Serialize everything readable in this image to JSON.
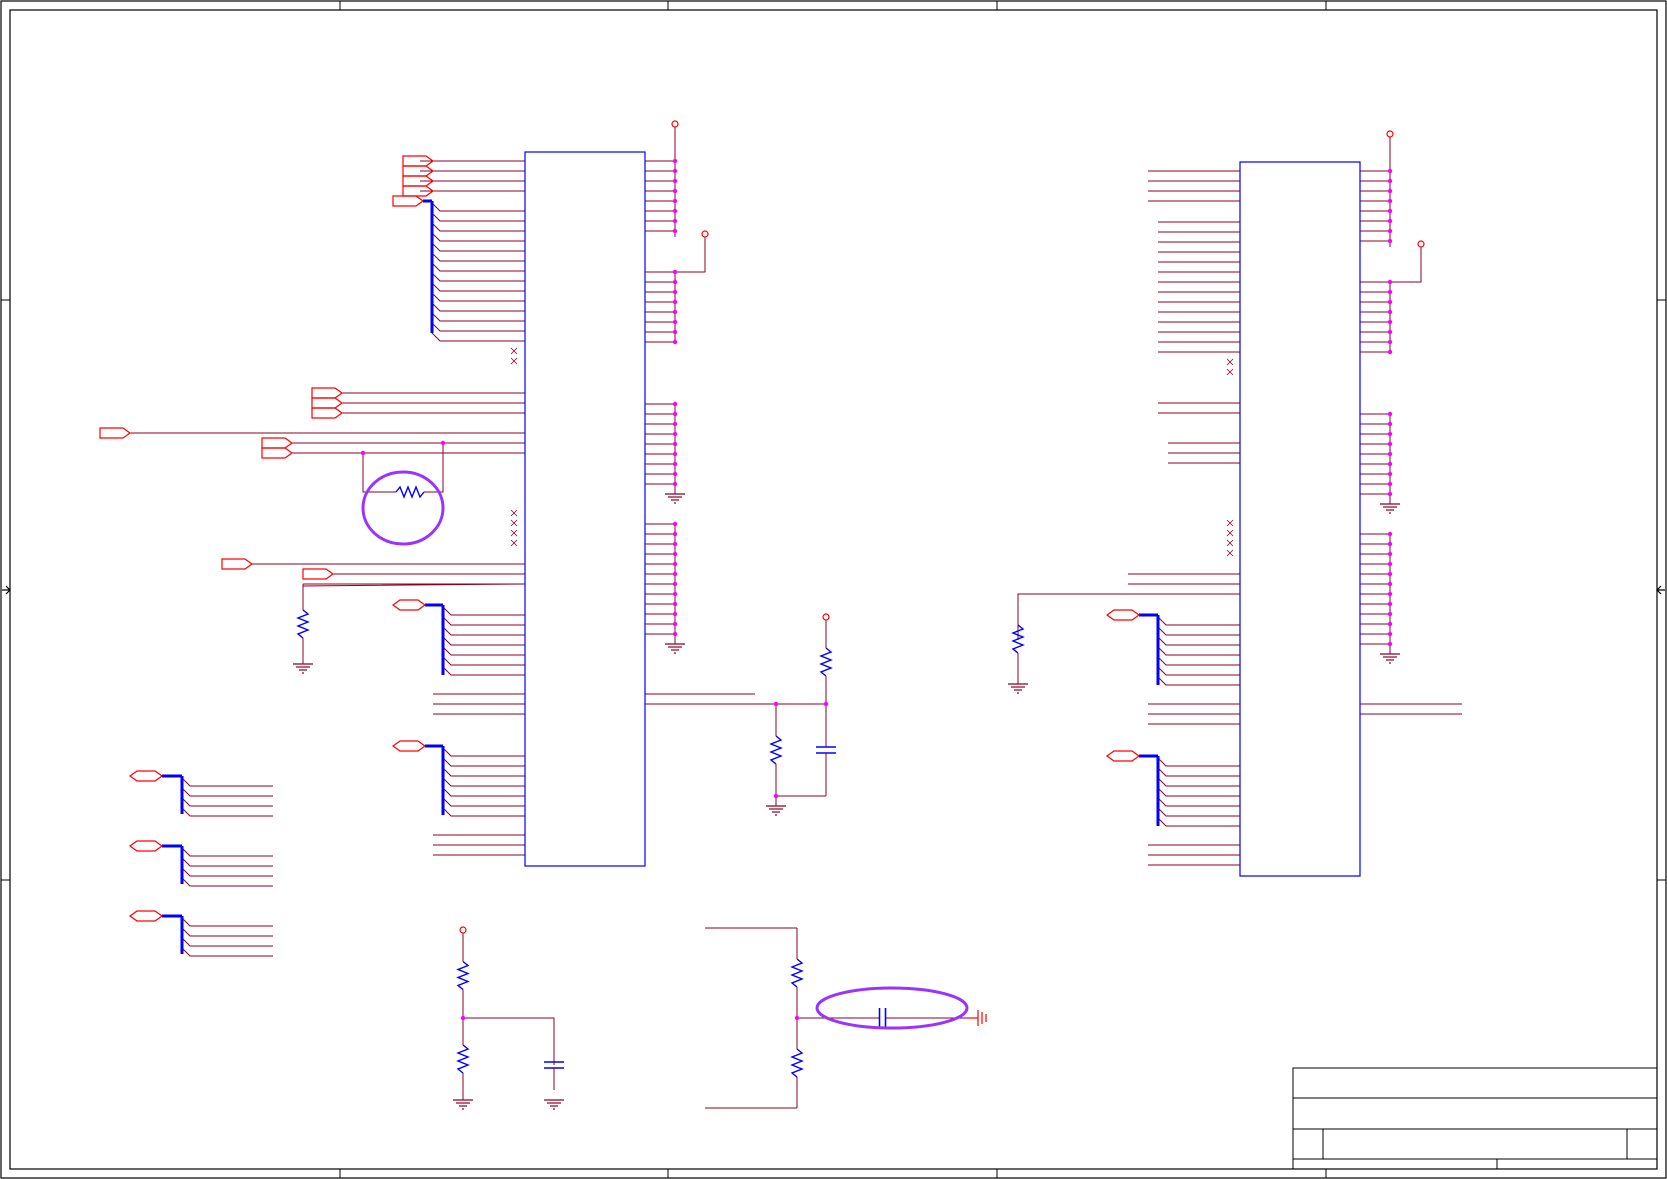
{
  "sheet": {
    "colors": {
      "border": "#000000",
      "wire": "#8b0026",
      "bus": "#0000ff",
      "port": "#ff0000",
      "junction": "#ff00ff",
      "component": "#0000ff",
      "part_outline": "#0000ff",
      "highlight": "#9933ff",
      "ground": "#8b0026",
      "power": "#ff0000"
    },
    "title_block": {
      "title": "",
      "document_number": "",
      "revision": "",
      "sheet": ""
    }
  },
  "components": [
    {
      "name": "ic-left",
      "type": "ic"
    },
    {
      "name": "ic-right",
      "type": "ic"
    },
    {
      "name": "resistor-highlighted",
      "type": "resistor"
    },
    {
      "name": "capacitor-highlighted",
      "type": "capacitor"
    }
  ],
  "highlights": [
    {
      "name": "highlight-ellipse-resistor",
      "shape": "ellipse"
    },
    {
      "name": "highlight-ellipse-capacitor",
      "shape": "ellipse"
    }
  ],
  "icons": [
    "resistor-icon",
    "capacitor-icon",
    "ground-icon",
    "power-port-icon",
    "off-page-connector-icon",
    "no-connect-icon",
    "chassis-ground-icon",
    "arrow-marker-icon"
  ]
}
